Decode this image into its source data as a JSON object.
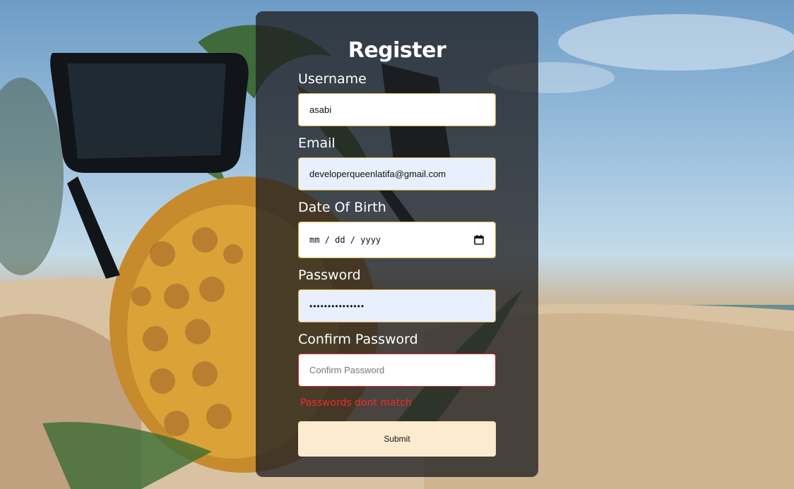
{
  "form": {
    "title": "Register",
    "username": {
      "label": "Username",
      "value": "asabi"
    },
    "email": {
      "label": "Email",
      "value": "developerqueenlatifa@gmail.com"
    },
    "dob": {
      "label": "Date Of Birth",
      "value": "mm / dd / yyyy"
    },
    "password": {
      "label": "Password",
      "value": "•••••••••••••••"
    },
    "confirm": {
      "label": "Confirm Password",
      "placeholder": "Confirm Password"
    },
    "error": "Passwords dont match",
    "submit_label": "Submit"
  },
  "icons": {
    "date_picker": "calendar-icon"
  },
  "colors": {
    "card": "#202022",
    "autofill": "#e8f0fe",
    "error": "#ef2b2b",
    "submit": "#fdebcf",
    "border": "#d4a93a"
  }
}
